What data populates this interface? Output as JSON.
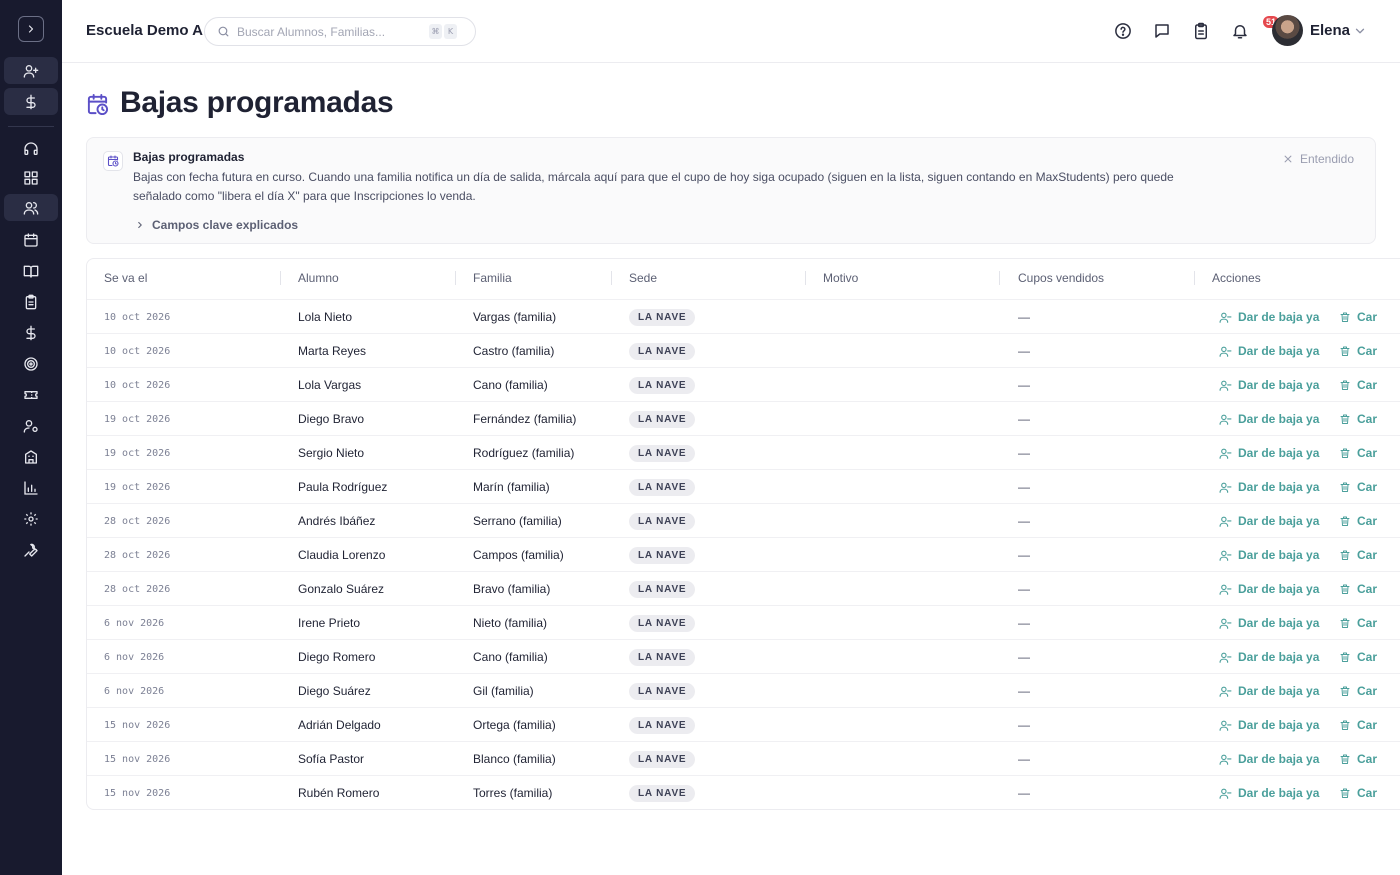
{
  "header": {
    "school_name": "Escuela Demo A",
    "search_placeholder": "Buscar Alumnos, Familias...",
    "shortcut_keys": [
      "⌘",
      "K"
    ],
    "notifications_count": "51",
    "user_name": "Elena"
  },
  "page": {
    "title": "Bajas programadas"
  },
  "info_panel": {
    "title": "Bajas programadas",
    "body": "Bajas con fecha futura en curso. Cuando una familia notifica un día de salida, márcala aquí para que el cupo de hoy siga ocupado (siguen en la lista, siguen contando en MaxStudents) pero quede señalado como \"libera el día X\" para que Inscripciones lo venda.",
    "dismiss_label": "Entendido",
    "expand_label": "Campos clave explicados"
  },
  "table": {
    "columns": [
      "Se va el",
      "Alumno",
      "Familia",
      "Sede",
      "Motivo",
      "Cupos vendidos",
      "Acciones"
    ],
    "action_primary": "Dar de baja ya",
    "action_secondary": "Car",
    "rows": [
      {
        "date": "10 oct 2026",
        "student": "Lola Nieto",
        "family": "Vargas (familia)",
        "sede": "LA NAVE",
        "motivo": "",
        "cupos": "—"
      },
      {
        "date": "10 oct 2026",
        "student": "Marta Reyes",
        "family": "Castro (familia)",
        "sede": "LA NAVE",
        "motivo": "",
        "cupos": "—"
      },
      {
        "date": "10 oct 2026",
        "student": "Lola Vargas",
        "family": "Cano (familia)",
        "sede": "LA NAVE",
        "motivo": "",
        "cupos": "—"
      },
      {
        "date": "19 oct 2026",
        "student": "Diego Bravo",
        "family": "Fernández (familia)",
        "sede": "LA NAVE",
        "motivo": "",
        "cupos": "—"
      },
      {
        "date": "19 oct 2026",
        "student": "Sergio Nieto",
        "family": "Rodríguez (familia)",
        "sede": "LA NAVE",
        "motivo": "",
        "cupos": "—"
      },
      {
        "date": "19 oct 2026",
        "student": "Paula Rodríguez",
        "family": "Marín (familia)",
        "sede": "LA NAVE",
        "motivo": "",
        "cupos": "—"
      },
      {
        "date": "28 oct 2026",
        "student": "Andrés Ibáñez",
        "family": "Serrano (familia)",
        "sede": "LA NAVE",
        "motivo": "",
        "cupos": "—"
      },
      {
        "date": "28 oct 2026",
        "student": "Claudia Lorenzo",
        "family": "Campos (familia)",
        "sede": "LA NAVE",
        "motivo": "",
        "cupos": "—"
      },
      {
        "date": "28 oct 2026",
        "student": "Gonzalo Suárez",
        "family": "Bravo (familia)",
        "sede": "LA NAVE",
        "motivo": "",
        "cupos": "—"
      },
      {
        "date": "6 nov 2026",
        "student": "Irene Prieto",
        "family": "Nieto (familia)",
        "sede": "LA NAVE",
        "motivo": "",
        "cupos": "—"
      },
      {
        "date": "6 nov 2026",
        "student": "Diego Romero",
        "family": "Cano (familia)",
        "sede": "LA NAVE",
        "motivo": "",
        "cupos": "—"
      },
      {
        "date": "6 nov 2026",
        "student": "Diego Suárez",
        "family": "Gil (familia)",
        "sede": "LA NAVE",
        "motivo": "",
        "cupos": "—"
      },
      {
        "date": "15 nov 2026",
        "student": "Adrián Delgado",
        "family": "Ortega (familia)",
        "sede": "LA NAVE",
        "motivo": "",
        "cupos": "—"
      },
      {
        "date": "15 nov 2026",
        "student": "Sofía Pastor",
        "family": "Blanco (familia)",
        "sede": "LA NAVE",
        "motivo": "",
        "cupos": "—"
      },
      {
        "date": "15 nov 2026",
        "student": "Rubén Romero",
        "family": "Torres (familia)",
        "sede": "LA NAVE",
        "motivo": "",
        "cupos": "—"
      }
    ]
  },
  "sidebar": {
    "icons": [
      "add-user-icon",
      "dollar-icon",
      "headset-icon",
      "grid-icon",
      "users-icon",
      "calendar-icon",
      "book-icon",
      "clipboard-icon",
      "dollar-icon",
      "target-icon",
      "ticket-icon",
      "user-settings-icon",
      "building-icon",
      "bar-chart-icon",
      "gear-icon",
      "wrench-icon"
    ]
  },
  "colors": {
    "sidebar_bg": "#181a2e",
    "accent_teal": "#4a9f9b",
    "badge_red": "#e5484d",
    "title_icon_purple": "#5b4fc7"
  }
}
